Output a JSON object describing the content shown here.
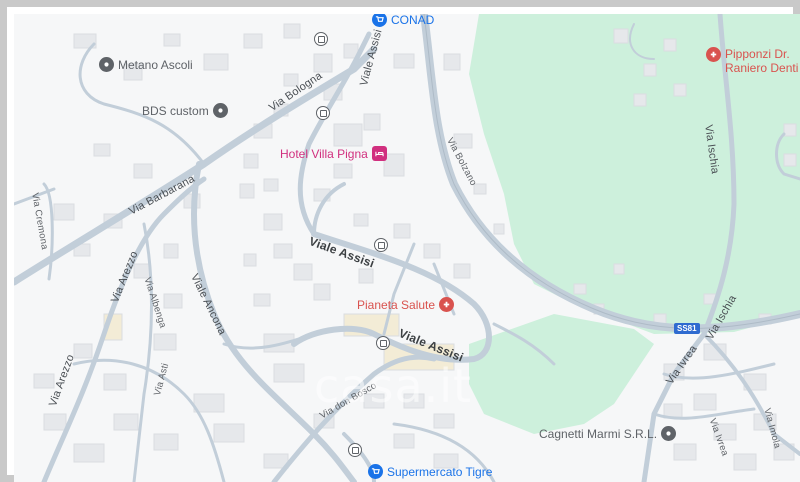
{
  "colors": {
    "park": "#cdf0dc",
    "road": "#c2ced9",
    "road_edge": "#aebbc7",
    "building": "#e8eaed",
    "pin_gray": "#5f6368",
    "pin_pink": "#d1307f",
    "pin_red": "#d9534f",
    "pin_blue": "#1a73e8",
    "shield": "#2f6bd0"
  },
  "pois": [
    {
      "id": "conad",
      "label": "CONAD",
      "icon": "shopping-cart-icon",
      "color": "blue"
    },
    {
      "id": "pipponzi",
      "label": "Pipponzi Dr. Raniero Denti",
      "line1": "Pipponzi Dr.",
      "line2": "Raniero Denti",
      "icon": "medical-icon",
      "color": "red"
    },
    {
      "id": "metano",
      "label": "Metano Ascoli",
      "icon": "place-icon",
      "color": "gray"
    },
    {
      "id": "bds",
      "label": "BDS custom",
      "icon": "place-icon",
      "color": "gray"
    },
    {
      "id": "hotel",
      "label": "Hotel Villa Pigna",
      "icon": "bed-icon",
      "color": "pink"
    },
    {
      "id": "salute",
      "label": "Pianeta Salute",
      "icon": "medical-icon",
      "color": "red"
    },
    {
      "id": "cagnetti",
      "label": "Cagnetti Marmi S.R.L.",
      "icon": "place-icon",
      "color": "gray"
    },
    {
      "id": "tigre",
      "label": "Supermercato Tigre",
      "icon": "shopping-cart-icon",
      "color": "blue"
    }
  ],
  "roads": {
    "bologna": "Via Bologna",
    "barbarana": "Via Barbarana",
    "viale_assisi_top": "Viale Assisi",
    "bolzano": "Via Bolzano",
    "cremona": "Via Cremona",
    "arezzo_1": "Via Arezzo",
    "arezzo_2": "Via Arezzo",
    "albenga": "Via Albenga",
    "ancona": "Viale Ancona",
    "assisi_1": "Viale Assisi",
    "assisi_2": "Viale Assisi",
    "don_bosco": "Via don Bosco",
    "asti": "Via Asti",
    "ischia_1": "Via Ischia",
    "ischia_2": "Via Ischia",
    "ivrea_1": "Via Ivrea",
    "ivrea_2": "Via Ivrea",
    "imola": "Via Imola"
  },
  "shield": "SS81",
  "watermark": "casa.it"
}
